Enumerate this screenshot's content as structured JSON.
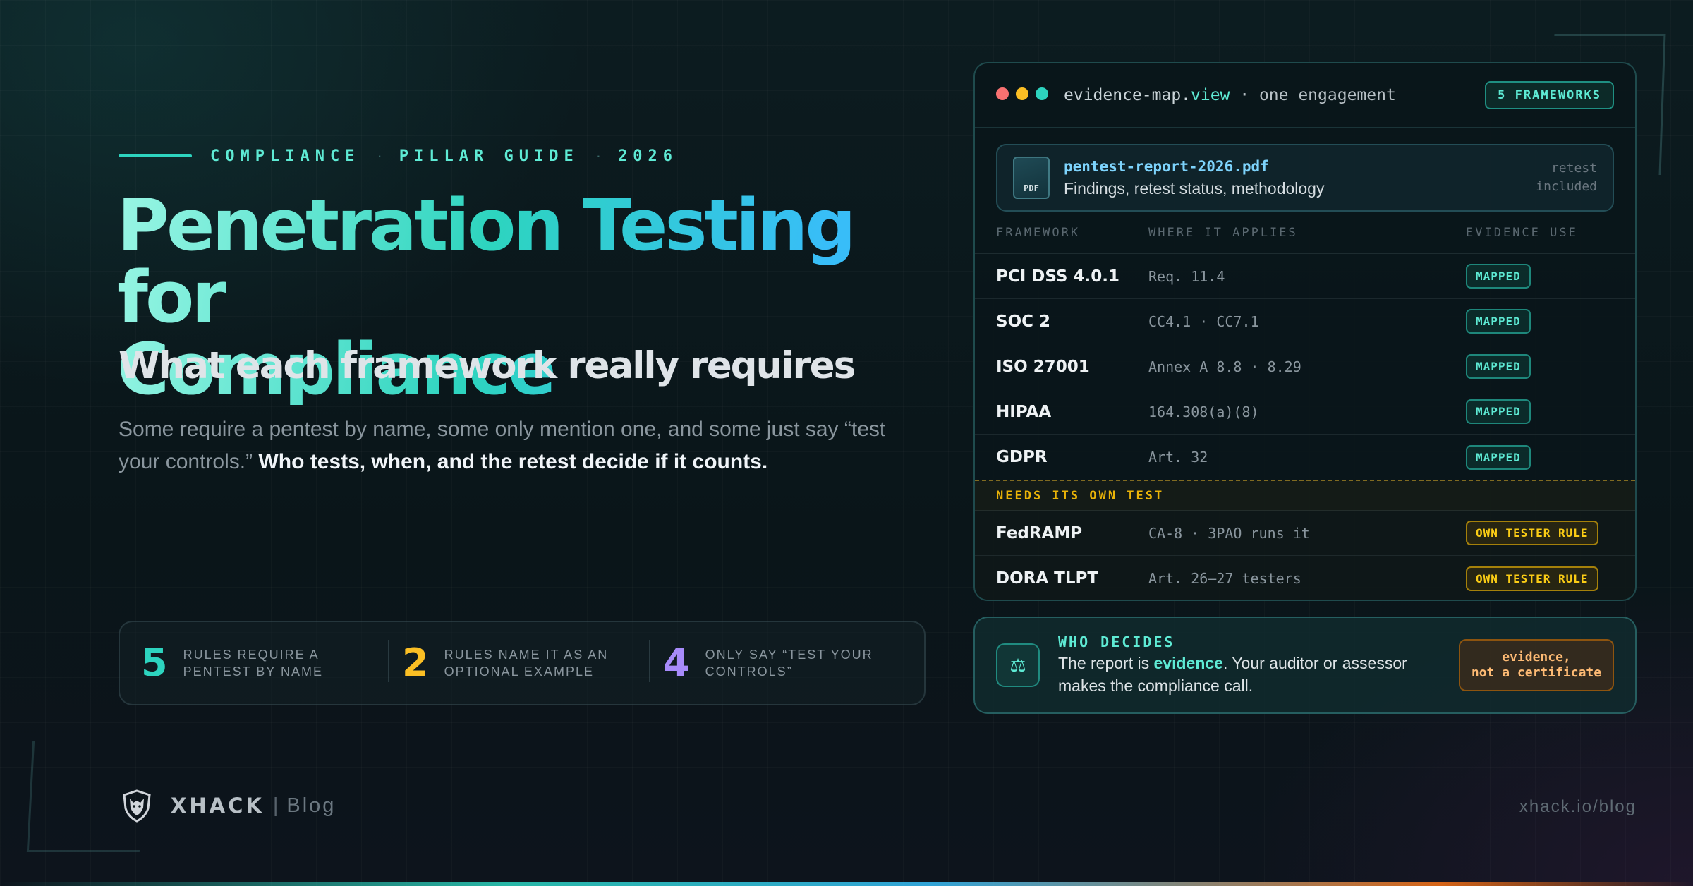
{
  "eyebrow": {
    "cat": "COMPLIANCE",
    "kind": "PILLAR GUIDE",
    "year": "2026"
  },
  "title": {
    "line1": "Penetration Testing for",
    "line2": "Compliance"
  },
  "subtitle": "What each framework really requires",
  "description": {
    "text": "Some require a pentest by name, some only mention one, and some just say “test your controls.”",
    "bold": "Who tests, when, and the retest decide if it counts."
  },
  "stats": [
    {
      "num": "5",
      "label": "RULES REQUIRE A PENTEST BY NAME",
      "color": "#2dd4bf"
    },
    {
      "num": "2",
      "label": "RULES NAME IT AS AN OPTIONAL EXAMPLE",
      "color": "#fbbf24"
    },
    {
      "num": "4",
      "label": "ONLY SAY “TEST YOUR CONTROLS”",
      "color": "#a78bfa"
    }
  ],
  "brand": {
    "name": "XHACK",
    "sep": "|",
    "sub": "Blog",
    "url": "xhack.io/blog"
  },
  "panel": {
    "file_base": "evidence-map.",
    "file_ext": "view",
    "file_rest": " · one engagement",
    "badge": "5 FRAMEWORKS",
    "dot_colors": [
      "#f87171",
      "#fbbf24",
      "#2dd4bf"
    ],
    "report": {
      "icon_label": "PDF",
      "filename": "pentest-report-2026.pdf",
      "desc": "Findings, retest status, methodology",
      "note1": "retest",
      "note2": "included"
    },
    "headers": [
      "FRAMEWORK",
      "WHERE IT APPLIES",
      "EVIDENCE USE"
    ],
    "rows": [
      {
        "fw": "PCI DSS 4.0.1",
        "applies": "Req. 11.4",
        "use": "MAPPED"
      },
      {
        "fw": "SOC 2",
        "applies": "CC4.1 · CC7.1",
        "use": "MAPPED"
      },
      {
        "fw": "ISO 27001",
        "applies": "Annex A 8.8 · 8.29",
        "use": "MAPPED"
      },
      {
        "fw": "HIPAA",
        "applies": "164.308(a)(8)",
        "use": "MAPPED"
      },
      {
        "fw": "GDPR",
        "applies": "Art. 32",
        "use": "MAPPED"
      }
    ],
    "needs_label": "NEEDS ITS OWN TEST",
    "own_rows": [
      {
        "fw": "FedRAMP",
        "applies": "CA-8 · 3PAO runs it",
        "use": "OWN TESTER RULE"
      },
      {
        "fw": "DORA TLPT",
        "applies": "Art. 26–27 testers",
        "use": "OWN TESTER RULE"
      }
    ]
  },
  "who": {
    "icon": "scales-icon",
    "title": "WHO DECIDES",
    "pre": "The report is ",
    "em": "evidence",
    "post": ". Your auditor or assessor makes the compliance call.",
    "cert1": "evidence,",
    "cert2": "not a certificate"
  }
}
